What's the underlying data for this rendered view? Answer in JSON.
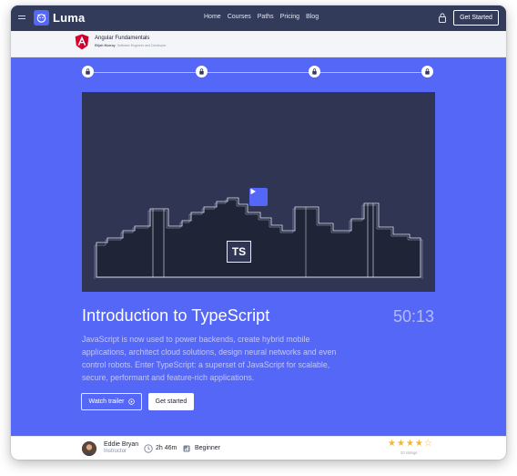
{
  "nav": {
    "brand": "Luma",
    "links": [
      "Home",
      "Courses",
      "Paths",
      "Pricing",
      "Blog"
    ],
    "cta": "Get Started"
  },
  "course": {
    "title": "Angular Fundamentals",
    "author": "Elijah Murray",
    "author_role": "Software Engineer and Developer"
  },
  "lesson": {
    "video_badge": "TS",
    "title": "Introduction to TypeScript",
    "duration": "50:13",
    "description": "JavaScript is now used to power backends, create hybrid mobile applications, architect cloud solutions, design neural networks and even control robots. Enter TypeScript: a superset of JavaScript for scalable, secure, performant and feature-rich applications.",
    "watch_trailer": "Watch trailer",
    "get_started": "Get started"
  },
  "footer": {
    "instructor_name": "Eddie Bryan",
    "instructor_role": "Instructor",
    "course_length": "2h 46m",
    "level": "Beginner",
    "rating": 4,
    "rating_max": 5,
    "ratings_count": "20 ratings"
  },
  "colors": {
    "brand": "#5567f7",
    "nav_bg": "#323b5a",
    "star": "#f3b72d",
    "angular": "#dd0031"
  }
}
